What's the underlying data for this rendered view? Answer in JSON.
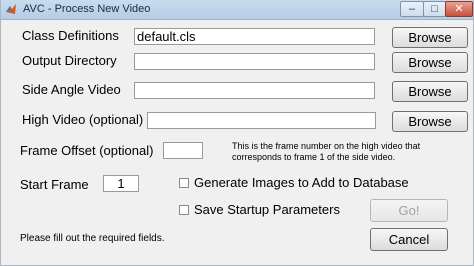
{
  "window": {
    "title": "AVC - Process New Video",
    "min_glyph": "–",
    "max_glyph": "□",
    "close_glyph": "✕"
  },
  "form": {
    "class_definitions": {
      "label": "Class Definitions",
      "value": "default.cls",
      "browse": "Browse"
    },
    "output_directory": {
      "label": "Output Directory",
      "value": "",
      "browse": "Browse"
    },
    "side_angle_video": {
      "label": "Side Angle Video",
      "value": "",
      "browse": "Browse"
    },
    "high_video": {
      "label": "High Video (optional)",
      "value": "",
      "browse": "Browse"
    },
    "frame_offset": {
      "label": "Frame Offset (optional)",
      "value": "",
      "help_line1": "This is the frame number on the high video that",
      "help_line2": "corresponds to frame 1 of the side video."
    },
    "start_frame": {
      "label": "Start Frame",
      "value": "1"
    },
    "generate_images": {
      "label": "Generate Images to Add to Database",
      "checked": false
    },
    "save_startup": {
      "label": "Save Startup Parameters",
      "checked": false
    }
  },
  "buttons": {
    "go": "Go!",
    "cancel": "Cancel"
  },
  "status": "Please fill out the required fields."
}
